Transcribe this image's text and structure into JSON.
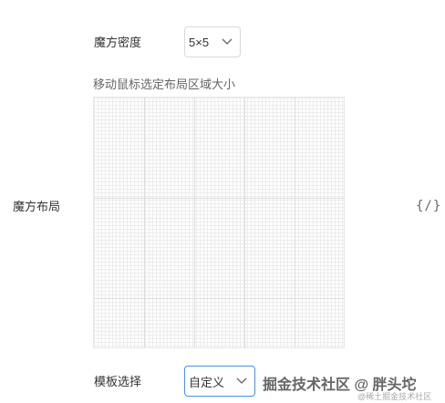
{
  "density": {
    "label": "魔方密度",
    "value": "5×5"
  },
  "hint": "移动鼠标选定布局区域大小",
  "layout": {
    "label": "魔方布局",
    "code_icon_text": "{/}"
  },
  "template": {
    "label": "模板选择",
    "value": "自定义"
  },
  "watermark": {
    "main": "掘金技术社区 @ 胖头坨",
    "sub": "@稀土掘金技术社区"
  },
  "colors": {
    "accent": "#4a90e2",
    "border": "#d9d9d9"
  },
  "icons": {
    "select_arrow": "chevron-down-icon",
    "code": "code-icon"
  }
}
